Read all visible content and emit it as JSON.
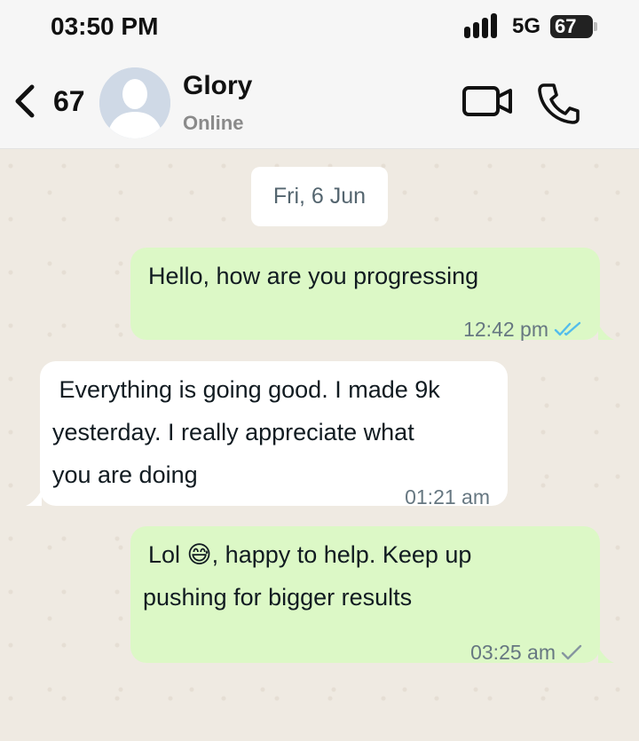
{
  "status_bar": {
    "time": "03:50 PM",
    "network": "5G",
    "battery": "67"
  },
  "header": {
    "unread_count": "67",
    "contact_name": "Glory",
    "presence": "Online",
    "icons": [
      "back-chevron-icon",
      "video-call-icon",
      "phone-call-icon"
    ]
  },
  "chat": {
    "date_label": "Fri, 6 Jun",
    "messages": [
      {
        "direction": "outgoing",
        "lines": [
          "Hello, how are you progressing"
        ],
        "time": "12:42 pm",
        "status": "read"
      },
      {
        "direction": "incoming",
        "lines": [
          " Everything is going good. I made 9k",
          "yesterday. I really appreciate what",
          "you are doing"
        ],
        "time": "01:21 am"
      },
      {
        "direction": "outgoing",
        "lines": [
          "Lol 😅, happy to help. Keep up",
          "pushing for bigger results"
        ],
        "time": "03:25 am",
        "status": "sent"
      }
    ]
  },
  "colors": {
    "outgoing_bubble": "#dcf8c6",
    "incoming_bubble": "#ffffff",
    "chat_background": "#efeae2",
    "read_ticks": "#53bdeb",
    "sent_tick": "#8696a0"
  }
}
